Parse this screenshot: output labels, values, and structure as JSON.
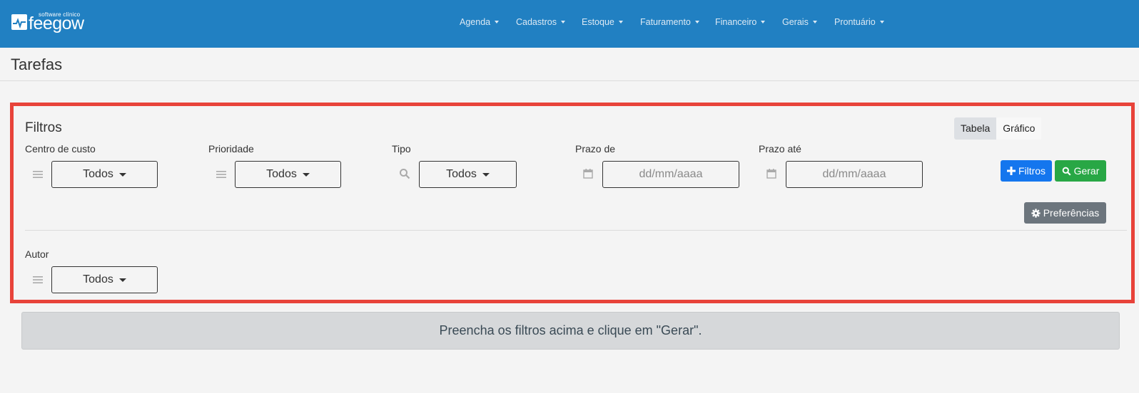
{
  "brand": {
    "small": "software clínico",
    "name": "feegow"
  },
  "nav": [
    {
      "label": "Agenda"
    },
    {
      "label": "Cadastros"
    },
    {
      "label": "Estoque"
    },
    {
      "label": "Faturamento"
    },
    {
      "label": "Financeiro"
    },
    {
      "label": "Gerais"
    },
    {
      "label": "Prontuário"
    }
  ],
  "page": {
    "title": "Tarefas"
  },
  "filters": {
    "title": "Filtros",
    "view_toggle": {
      "table": "Tabela",
      "chart": "Gráfico",
      "selected": "Tabela"
    },
    "centro_custo": {
      "label": "Centro de custo",
      "value": "Todos"
    },
    "prioridade": {
      "label": "Prioridade",
      "value": "Todos"
    },
    "tipo": {
      "label": "Tipo",
      "value": "Todos"
    },
    "prazo_de": {
      "label": "Prazo de",
      "placeholder": "dd/mm/aaaa"
    },
    "prazo_ate": {
      "label": "Prazo até",
      "placeholder": "dd/mm/aaaa"
    },
    "autor": {
      "label": "Autor",
      "value": "Todos"
    },
    "buttons": {
      "filtros": "Filtros",
      "gerar": "Gerar",
      "preferencias": "Preferências"
    }
  },
  "info_message": "Preencha os filtros acima e clique em \"Gerar\".",
  "colors": {
    "navbar": "#2180c2",
    "highlight_border": "#e8433a",
    "primary": "#1476ee",
    "success": "#28a745",
    "secondary": "#6c757d"
  },
  "icons": {
    "list": "list-icon",
    "search": "search-icon",
    "calendar": "calendar-icon",
    "plus": "plus-icon",
    "gear": "gear-icon"
  }
}
